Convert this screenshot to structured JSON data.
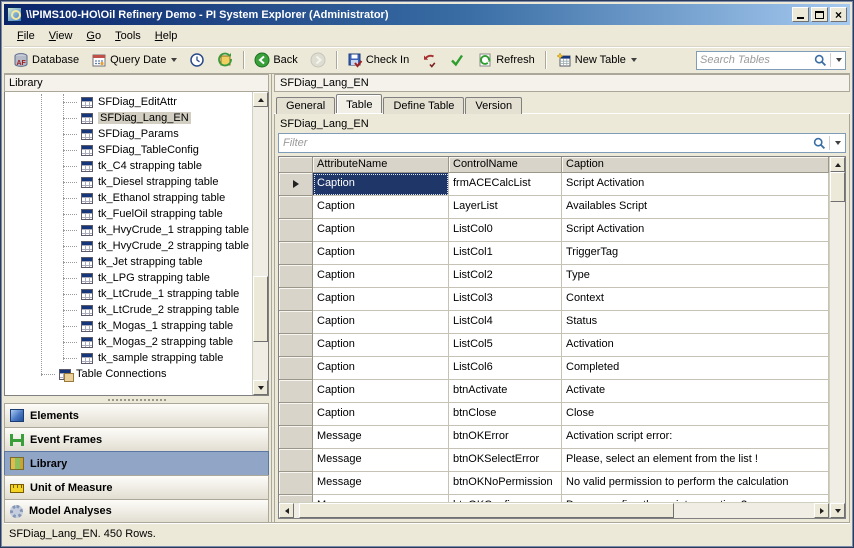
{
  "window": {
    "title": "\\\\PIMS100-HO\\Oil Refinery Demo - PI System Explorer (Administrator)"
  },
  "menu": {
    "items": [
      "File",
      "View",
      "Go",
      "Tools",
      "Help"
    ]
  },
  "toolbar": {
    "database_label": "Database",
    "query_date_label": "Query Date",
    "back_label": "Back",
    "check_in_label": "Check In",
    "refresh_label": "Refresh",
    "new_table_label": "New Table",
    "search_placeholder": "Search Tables"
  },
  "left_panel": {
    "header": "Library",
    "tree": [
      {
        "label": "SFDiag_EditAttr",
        "icon": "table",
        "level": 2,
        "selected": false
      },
      {
        "label": "SFDiag_Lang_EN",
        "icon": "table",
        "level": 2,
        "selected": true
      },
      {
        "label": "SFDiag_Params",
        "icon": "table",
        "level": 2,
        "selected": false
      },
      {
        "label": "SFDiag_TableConfig",
        "icon": "table",
        "level": 2,
        "selected": false
      },
      {
        "label": "tk_C4 strapping table",
        "icon": "table",
        "level": 2,
        "selected": false
      },
      {
        "label": "tk_Diesel strapping table",
        "icon": "table",
        "level": 2,
        "selected": false
      },
      {
        "label": "tk_Ethanol strapping table",
        "icon": "table",
        "level": 2,
        "selected": false
      },
      {
        "label": "tk_FuelOil strapping table",
        "icon": "table",
        "level": 2,
        "selected": false
      },
      {
        "label": "tk_HvyCrude_1 strapping table",
        "icon": "table",
        "level": 2,
        "selected": false
      },
      {
        "label": "tk_HvyCrude_2 strapping table",
        "icon": "table",
        "level": 2,
        "selected": false
      },
      {
        "label": "tk_Jet strapping table",
        "icon": "table",
        "level": 2,
        "selected": false
      },
      {
        "label": "tk_LPG strapping table",
        "icon": "table",
        "level": 2,
        "selected": false
      },
      {
        "label": "tk_LtCrude_1 strapping table",
        "icon": "table",
        "level": 2,
        "selected": false
      },
      {
        "label": "tk_LtCrude_2 strapping table",
        "icon": "table",
        "level": 2,
        "selected": false
      },
      {
        "label": "tk_Mogas_1 strapping table",
        "icon": "table",
        "level": 2,
        "selected": false
      },
      {
        "label": "tk_Mogas_2 strapping table",
        "icon": "table",
        "level": 2,
        "selected": false
      },
      {
        "label": "tk_sample strapping table",
        "icon": "table",
        "level": 2,
        "selected": false
      },
      {
        "label": "Table Connections",
        "icon": "connections",
        "level": 1,
        "selected": false
      }
    ],
    "nav": [
      {
        "label": "Elements",
        "icon": "elements",
        "name": "sidebar-item-elements",
        "selected": false
      },
      {
        "label": "Event Frames",
        "icon": "eventframes",
        "name": "sidebar-item-event-frames",
        "selected": false
      },
      {
        "label": "Library",
        "icon": "library",
        "name": "sidebar-item-library",
        "selected": true
      },
      {
        "label": "Unit of Measure",
        "icon": "uom",
        "name": "sidebar-item-unit-of-measure",
        "selected": false
      },
      {
        "label": "Model Analyses",
        "icon": "analyses",
        "name": "sidebar-item-model-analyses",
        "selected": false
      }
    ]
  },
  "right_panel": {
    "doc_title": "SFDiag_Lang_EN",
    "tabs": [
      {
        "label": "General",
        "active": false
      },
      {
        "label": "Table",
        "active": true
      },
      {
        "label": "Define Table",
        "active": false
      },
      {
        "label": "Version",
        "active": false
      }
    ],
    "table_name": "SFDiag_Lang_EN",
    "filter_placeholder": "Filter",
    "grid": {
      "columns": [
        "AttributeName",
        "ControlName",
        "Caption"
      ],
      "rows": [
        {
          "attribute": "Caption",
          "control": "frmACECalcList",
          "caption": "Script Activation",
          "selected": true
        },
        {
          "attribute": "Caption",
          "control": "LayerList",
          "caption": "Availables Script",
          "selected": false
        },
        {
          "attribute": "Caption",
          "control": "ListCol0",
          "caption": "Script Activation",
          "selected": false
        },
        {
          "attribute": "Caption",
          "control": "ListCol1",
          "caption": "TriggerTag",
          "selected": false
        },
        {
          "attribute": "Caption",
          "control": "ListCol2",
          "caption": "Type",
          "selected": false
        },
        {
          "attribute": "Caption",
          "control": "ListCol3",
          "caption": "Context",
          "selected": false
        },
        {
          "attribute": "Caption",
          "control": "ListCol4",
          "caption": "Status",
          "selected": false
        },
        {
          "attribute": "Caption",
          "control": "ListCol5",
          "caption": "Activation",
          "selected": false
        },
        {
          "attribute": "Caption",
          "control": "ListCol6",
          "caption": "Completed",
          "selected": false
        },
        {
          "attribute": "Caption",
          "control": "btnActivate",
          "caption": "Activate",
          "selected": false
        },
        {
          "attribute": "Caption",
          "control": "btnClose",
          "caption": "Close",
          "selected": false
        },
        {
          "attribute": "Message",
          "control": "btnOKError",
          "caption": "Activation script error:",
          "selected": false
        },
        {
          "attribute": "Message",
          "control": "btnOKSelectError",
          "caption": "Please, select an element from the list !",
          "selected": false
        },
        {
          "attribute": "Message",
          "control": "btnOKNoPermission",
          "caption": "No valid permission to perform the calculation",
          "selected": false
        },
        {
          "attribute": "Message",
          "control": "btnOKConfirm",
          "caption": "Do you confirm the script execution ?",
          "selected": false
        }
      ]
    }
  },
  "status_bar": {
    "text": "SFDiag_Lang_EN. 450 Rows."
  }
}
